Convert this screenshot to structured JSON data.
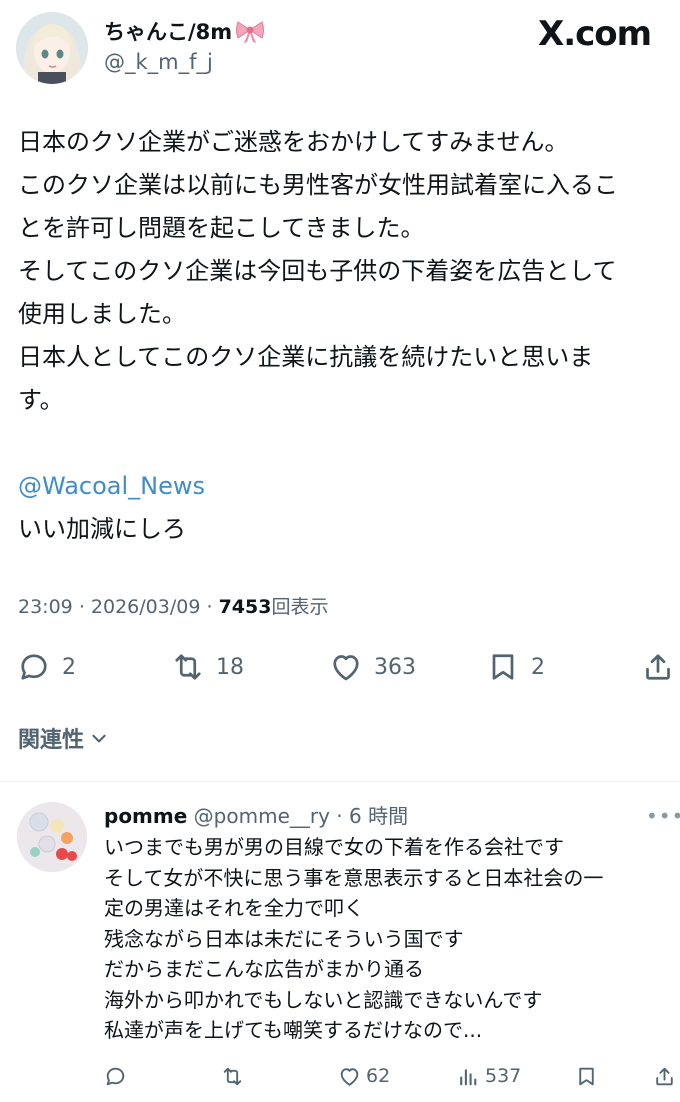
{
  "author": {
    "display_name": "ちゃんこ/8m",
    "handle": "@_k_m_f_j",
    "avatar": "anime-girl-avatar",
    "badge_icon": "ribbon-bow-icon"
  },
  "brand": "X.com",
  "tweet": {
    "lines": [
      "日本のクソ企業がご迷惑をおかけしてすみません。",
      "このクソ企業は以前にも男性客が女性用試着室に入るこ",
      "とを許可し問題を起こしてきました。",
      "そしてこのクソ企業は今回も子供の下着姿を広告として",
      "使用しました。",
      "日本人としてこのクソ企業に抗議を続けたいと思いま",
      "す。"
    ],
    "mention": "@Wacoal_News",
    "last_line": "いい加減にしろ",
    "time": "23:09",
    "date": "2026/03/09",
    "sep": "·",
    "views": "7453",
    "views_label": "回表示"
  },
  "actions": {
    "replies": "2",
    "retweets": "18",
    "likes": "363",
    "bookmarks": "2"
  },
  "related_label": "関連性",
  "reply": {
    "display_name": "pomme",
    "handle": "@pomme__ry",
    "time": "· 6 時間",
    "more": "•••",
    "lines": [
      "いつまでも男が男の目線で女の下着を作る会社です",
      "そして女が不快に思う事を意思表示すると日本社会の一",
      "定の男達はそれを全力で叩く",
      "残念ながら日本は未だにそういう国です",
      "だからまだこんな広告がまかり通る",
      "海外から叩かれでもしないと認識できないんです",
      "私達が声を上げても嘲笑するだけなので..."
    ],
    "likes": "62",
    "views": "537"
  },
  "colors": {
    "text": "#0f1419",
    "secondary": "#536471",
    "mention": "#3f8ccf",
    "divider": "#eff3f4"
  }
}
